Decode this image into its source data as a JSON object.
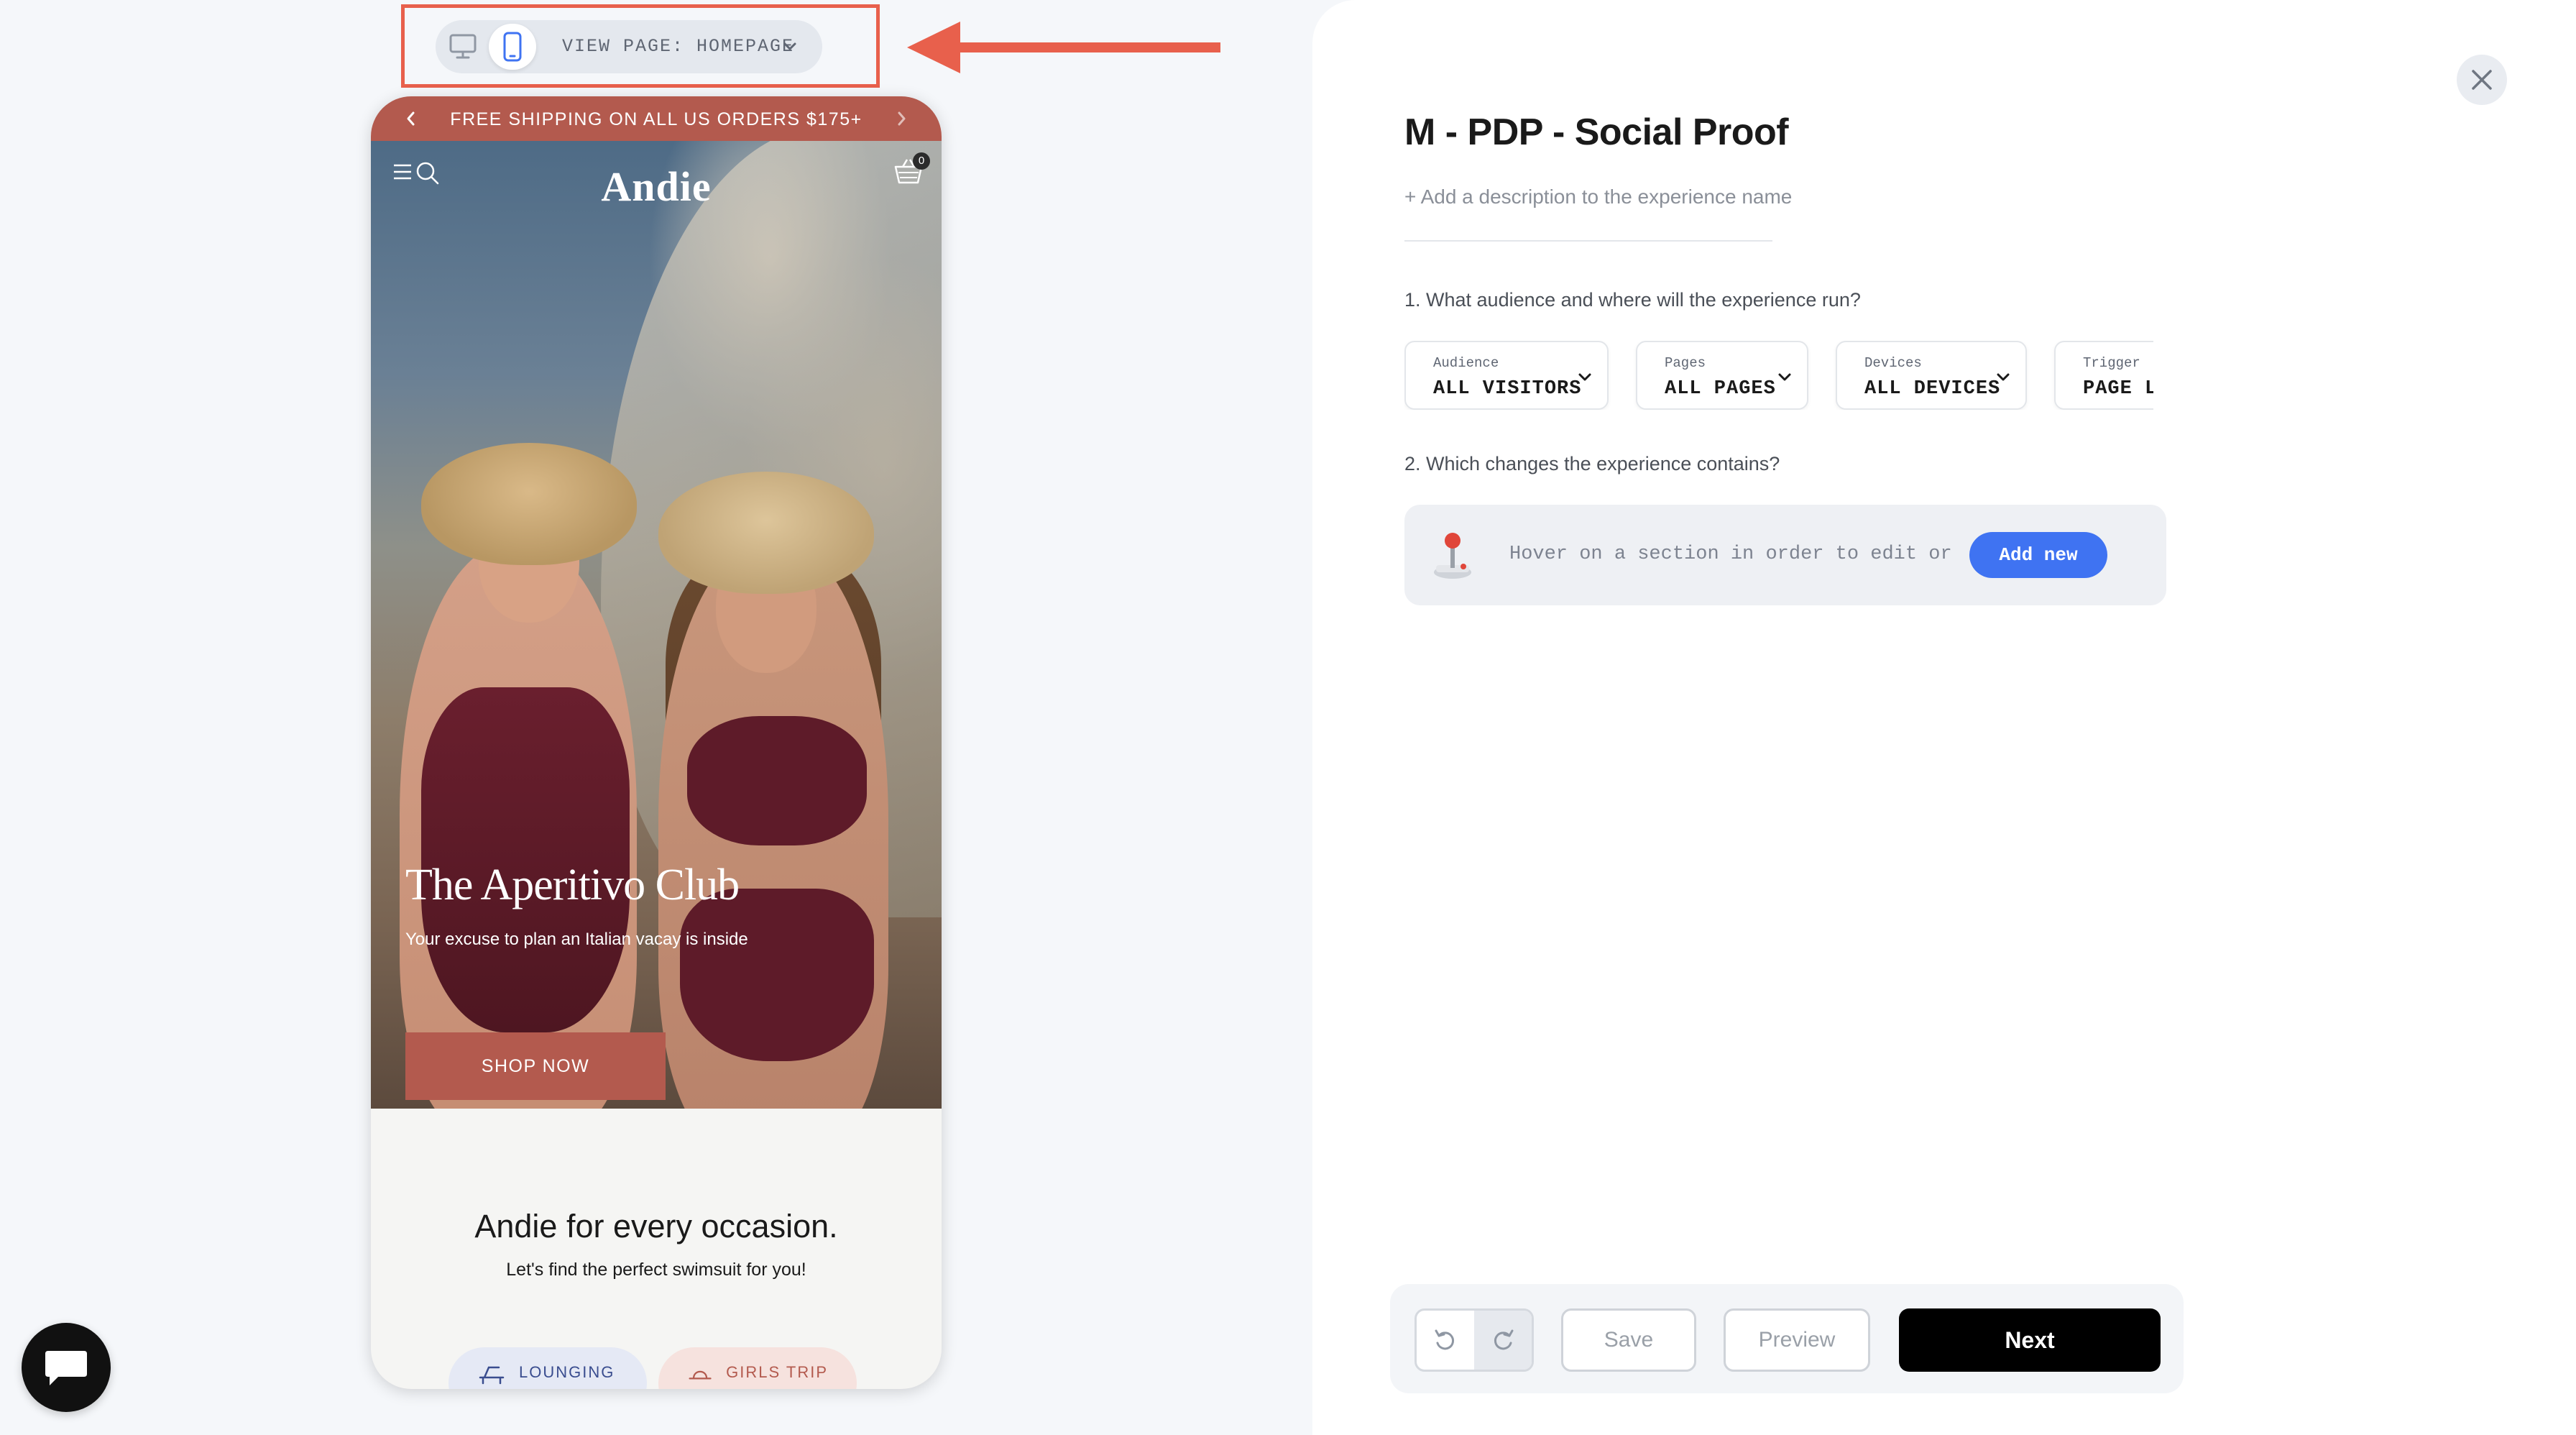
{
  "preview": {
    "view_page_label": "VIEW PAGE: HOMEPAGE",
    "selected_device": "mobile",
    "highlight_color": "#e8604c"
  },
  "site": {
    "promo_text": "FREE SHIPPING ON ALL US ORDERS $175+",
    "logo": "Andie",
    "cart_count": "0",
    "hero_title": "The Aperitivo Club",
    "hero_subtitle": "Your excuse to plan an Italian vacay is inside",
    "hero_cta": "SHOP NOW",
    "occasion_title": "Andie for every occasion.",
    "occasion_subtitle": "Let's find the perfect swimsuit for you!",
    "categories": [
      {
        "label": "LOUNGING",
        "icon": "lounge-chair-icon"
      },
      {
        "label": "GIRLS TRIP",
        "icon": "hat-icon"
      }
    ],
    "brand_color": "#b35a4e"
  },
  "editor": {
    "title": "M - PDP - Social Proof",
    "description_placeholder": "+ Add a description to the experience name",
    "question_audience": "1. What audience and where will the experience run?",
    "targeting": [
      {
        "label": "Audience",
        "value": "ALL VISITORS"
      },
      {
        "label": "Pages",
        "value": "ALL PAGES"
      },
      {
        "label": "Devices",
        "value": "ALL DEVICES"
      },
      {
        "label": "Trigger",
        "value": "PAGE LOAD"
      }
    ],
    "question_changes": "2. Which changes the experience contains?",
    "changes_hint": "Hover on a section in order to edit or",
    "add_new_label": "Add new",
    "accent_color": "#3f73f2"
  },
  "actions": {
    "save_label": "Save",
    "preview_label": "Preview",
    "next_label": "Next"
  }
}
